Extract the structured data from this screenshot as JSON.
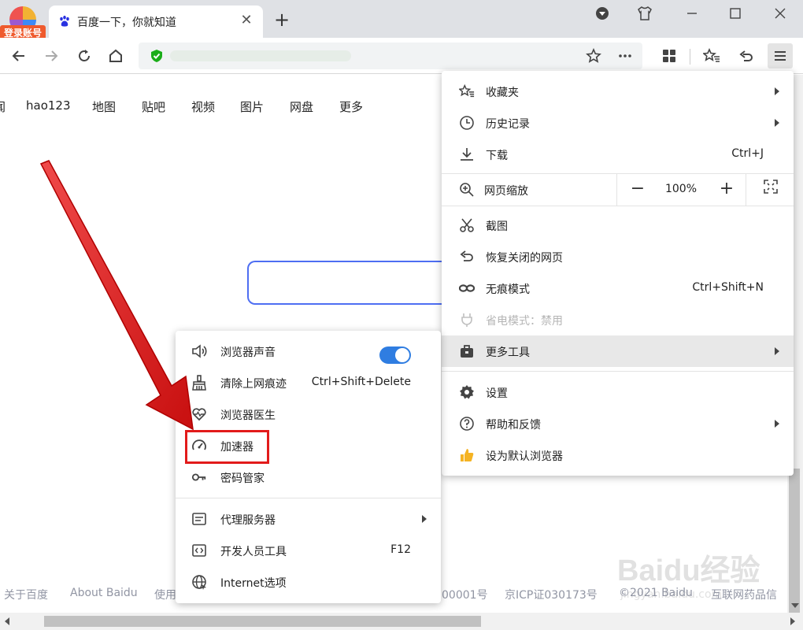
{
  "browser": {
    "login_badge": "登录账号",
    "tab_title": "百度一下，你就知道"
  },
  "page": {
    "nav_links": [
      "闻",
      "hao123",
      "地图",
      "贴吧",
      "视频",
      "图片",
      "网盘",
      "更多"
    ],
    "footer": [
      "关于百度",
      "About Baidu",
      "使用",
      "00001号",
      "京ICP证030173号",
      "©2021 Baidu",
      "互联网药品信"
    ],
    "watermark": {
      "logo": "Baidu经验",
      "url": "jingyan.baidu.com"
    }
  },
  "main_menu": {
    "items": [
      {
        "label": "收藏夹",
        "icon": "favorites-icon",
        "submenu": true
      },
      {
        "label": "历史记录",
        "icon": "history-icon",
        "submenu": true
      },
      {
        "label": "下载",
        "icon": "download-icon",
        "shortcut": "Ctrl+J"
      },
      {
        "label": "截图",
        "icon": "scissors-icon"
      },
      {
        "label": "恢复关闭的网页",
        "icon": "restore-icon"
      },
      {
        "label": "无痕模式",
        "icon": "incognito-icon",
        "shortcut": "Ctrl+Shift+N"
      },
      {
        "label": "省电模式：禁用",
        "icon": "power-plug-icon",
        "disabled": true
      },
      {
        "label": "更多工具",
        "icon": "toolbox-icon",
        "submenu": true,
        "highlighted": true
      },
      {
        "label": "设置",
        "icon": "gear-icon"
      },
      {
        "label": "帮助和反馈",
        "icon": "help-icon",
        "submenu": true
      },
      {
        "label": "设为默认浏览器",
        "icon": "thumbs-up-icon"
      }
    ],
    "zoom": {
      "label": "网页缩放",
      "value": "100%",
      "minus": "−",
      "plus": "+"
    }
  },
  "sub_menu": {
    "items": [
      {
        "label": "浏览器声音",
        "icon": "speaker-icon",
        "toggle": true
      },
      {
        "label": "清除上网痕迹",
        "icon": "broom-icon",
        "shortcut": "Ctrl+Shift+Delete"
      },
      {
        "label": "浏览器医生",
        "icon": "heart-pulse-icon"
      },
      {
        "label": "加速器",
        "icon": "speedometer-icon"
      },
      {
        "label": "密码管家",
        "icon": "key-icon"
      },
      {
        "label": "代理服务器",
        "icon": "proxy-icon",
        "submenu": true
      },
      {
        "label": "开发人员工具",
        "icon": "devtools-icon",
        "shortcut": "F12"
      },
      {
        "label": "Internet选项",
        "icon": "globe-icon"
      }
    ]
  },
  "colors": {
    "accent": "#2f7de1",
    "highlight_box": "#e21b1b",
    "shield": "#1aad19"
  }
}
